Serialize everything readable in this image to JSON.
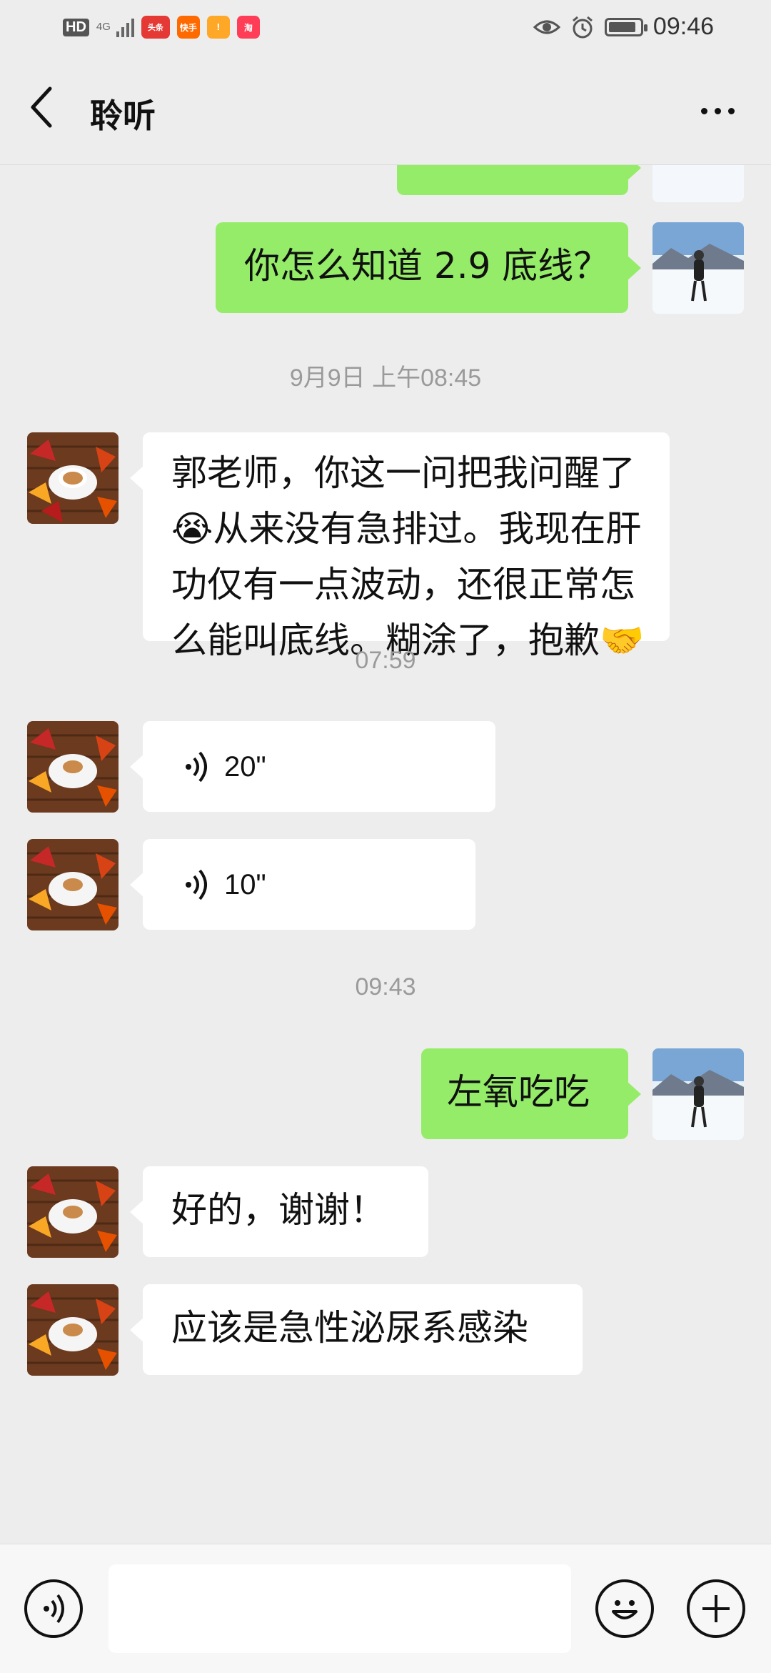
{
  "status_bar": {
    "hd": "HD",
    "network": "4G",
    "app_icons": [
      "头条",
      "快手",
      "!",
      "淘"
    ],
    "time": "09:46"
  },
  "header": {
    "title": "聆听",
    "back_icon": "chevron-left-icon",
    "more_icon": "more-dots-icon"
  },
  "messages": [
    {
      "type": "out",
      "text": "你怎么知道 2.9 底线？"
    },
    {
      "type": "time",
      "text": "9月9日 上午08:45"
    },
    {
      "type": "in",
      "text": "郭老师，你这一问把我问醒了😭从来没有急排过。我现在肝功仅有一点波动，还很正常怎么能叫底线。糊涂了，抱歉🤝"
    },
    {
      "type": "time",
      "text": "07:59"
    },
    {
      "type": "in-voice",
      "text": "20\""
    },
    {
      "type": "in-voice",
      "text": "10\""
    },
    {
      "type": "time",
      "text": "09:43"
    },
    {
      "type": "out",
      "text": "左氧吃吃"
    },
    {
      "type": "in",
      "text": "好的，谢谢！"
    },
    {
      "type": "in",
      "text": "应该是急性泌尿系感染"
    }
  ],
  "input_bar": {
    "voice_icon": "voice-input-icon",
    "emoji_icon": "emoji-icon",
    "plus_icon": "plus-icon",
    "input_value": ""
  },
  "colors": {
    "background": "#ededed",
    "outgoing_bubble": "#95ec69",
    "incoming_bubble": "#ffffff",
    "time_text": "#9a9a9a"
  }
}
